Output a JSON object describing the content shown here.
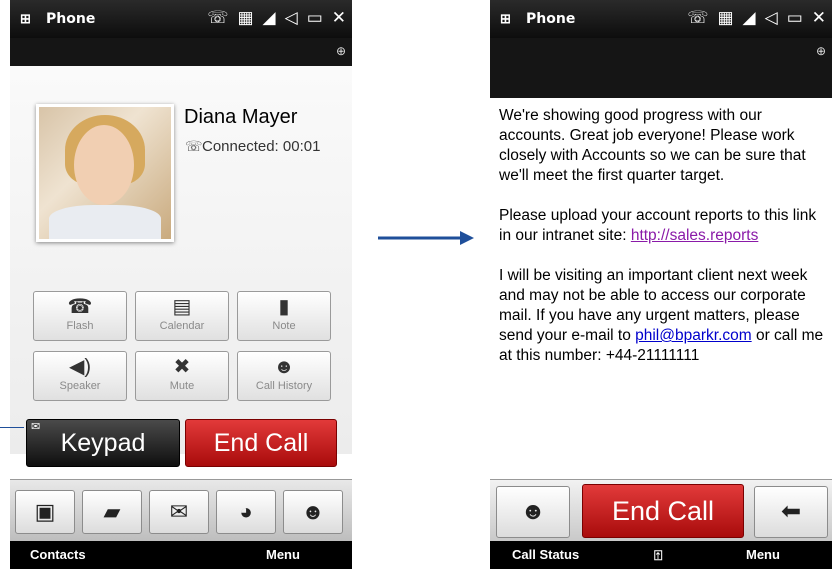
{
  "status_bar": {
    "app_title": "Phone",
    "icons": [
      "phone-connected-icon",
      "3g-icon",
      "signal-icon",
      "speaker-volume-icon",
      "battery-icon",
      "close-icon"
    ]
  },
  "left_screen": {
    "caller_name": "Diana Mayer",
    "call_status": "Connected: 00:01",
    "function_buttons": [
      {
        "label": "Flash",
        "icon": "flash-icon"
      },
      {
        "label": "Calendar",
        "icon": "calendar-icon"
      },
      {
        "label": "Note",
        "icon": "note-icon"
      },
      {
        "label": "Speaker",
        "icon": "speaker-icon"
      },
      {
        "label": "Mute",
        "icon": "mute-icon"
      },
      {
        "label": "Call History",
        "icon": "call-history-icon"
      }
    ],
    "keypad_label": "Keypad",
    "end_call_label": "End Call",
    "toolbar_icons": [
      "contact-card-icon",
      "sms-icon",
      "email-icon",
      "contact-clock-icon",
      "contacts-icon"
    ],
    "softkey_left": "Contacts",
    "softkey_right": "Menu"
  },
  "right_screen": {
    "paragraph_1": "We're showing good progress with our accounts. Great job everyone! Please work closely with Accounts so we can be sure that we'll meet the first quarter target.",
    "paragraph_2_text": "Please upload your account reports to this link in our intranet site: ",
    "paragraph_2_link": "http://sales.reports",
    "paragraph_3_text": "I will be visiting an important client next week and may not be able to access our corporate mail. If you have any urgent matters, please send your e-mail to ",
    "paragraph_3_link": "phil@bparkr.com",
    "paragraph_3_tail": " or call me at this number: +44-21111111",
    "end_call_label": "End Call",
    "softkey_left": "Call Status",
    "softkey_right": "Menu"
  },
  "colors": {
    "end_call_red": "#c41515",
    "keypad_black": "#1a1a1a",
    "link_purple": "#8a1aa8",
    "link_blue": "#0000cc",
    "arrow_blue": "#1f4f9a"
  }
}
